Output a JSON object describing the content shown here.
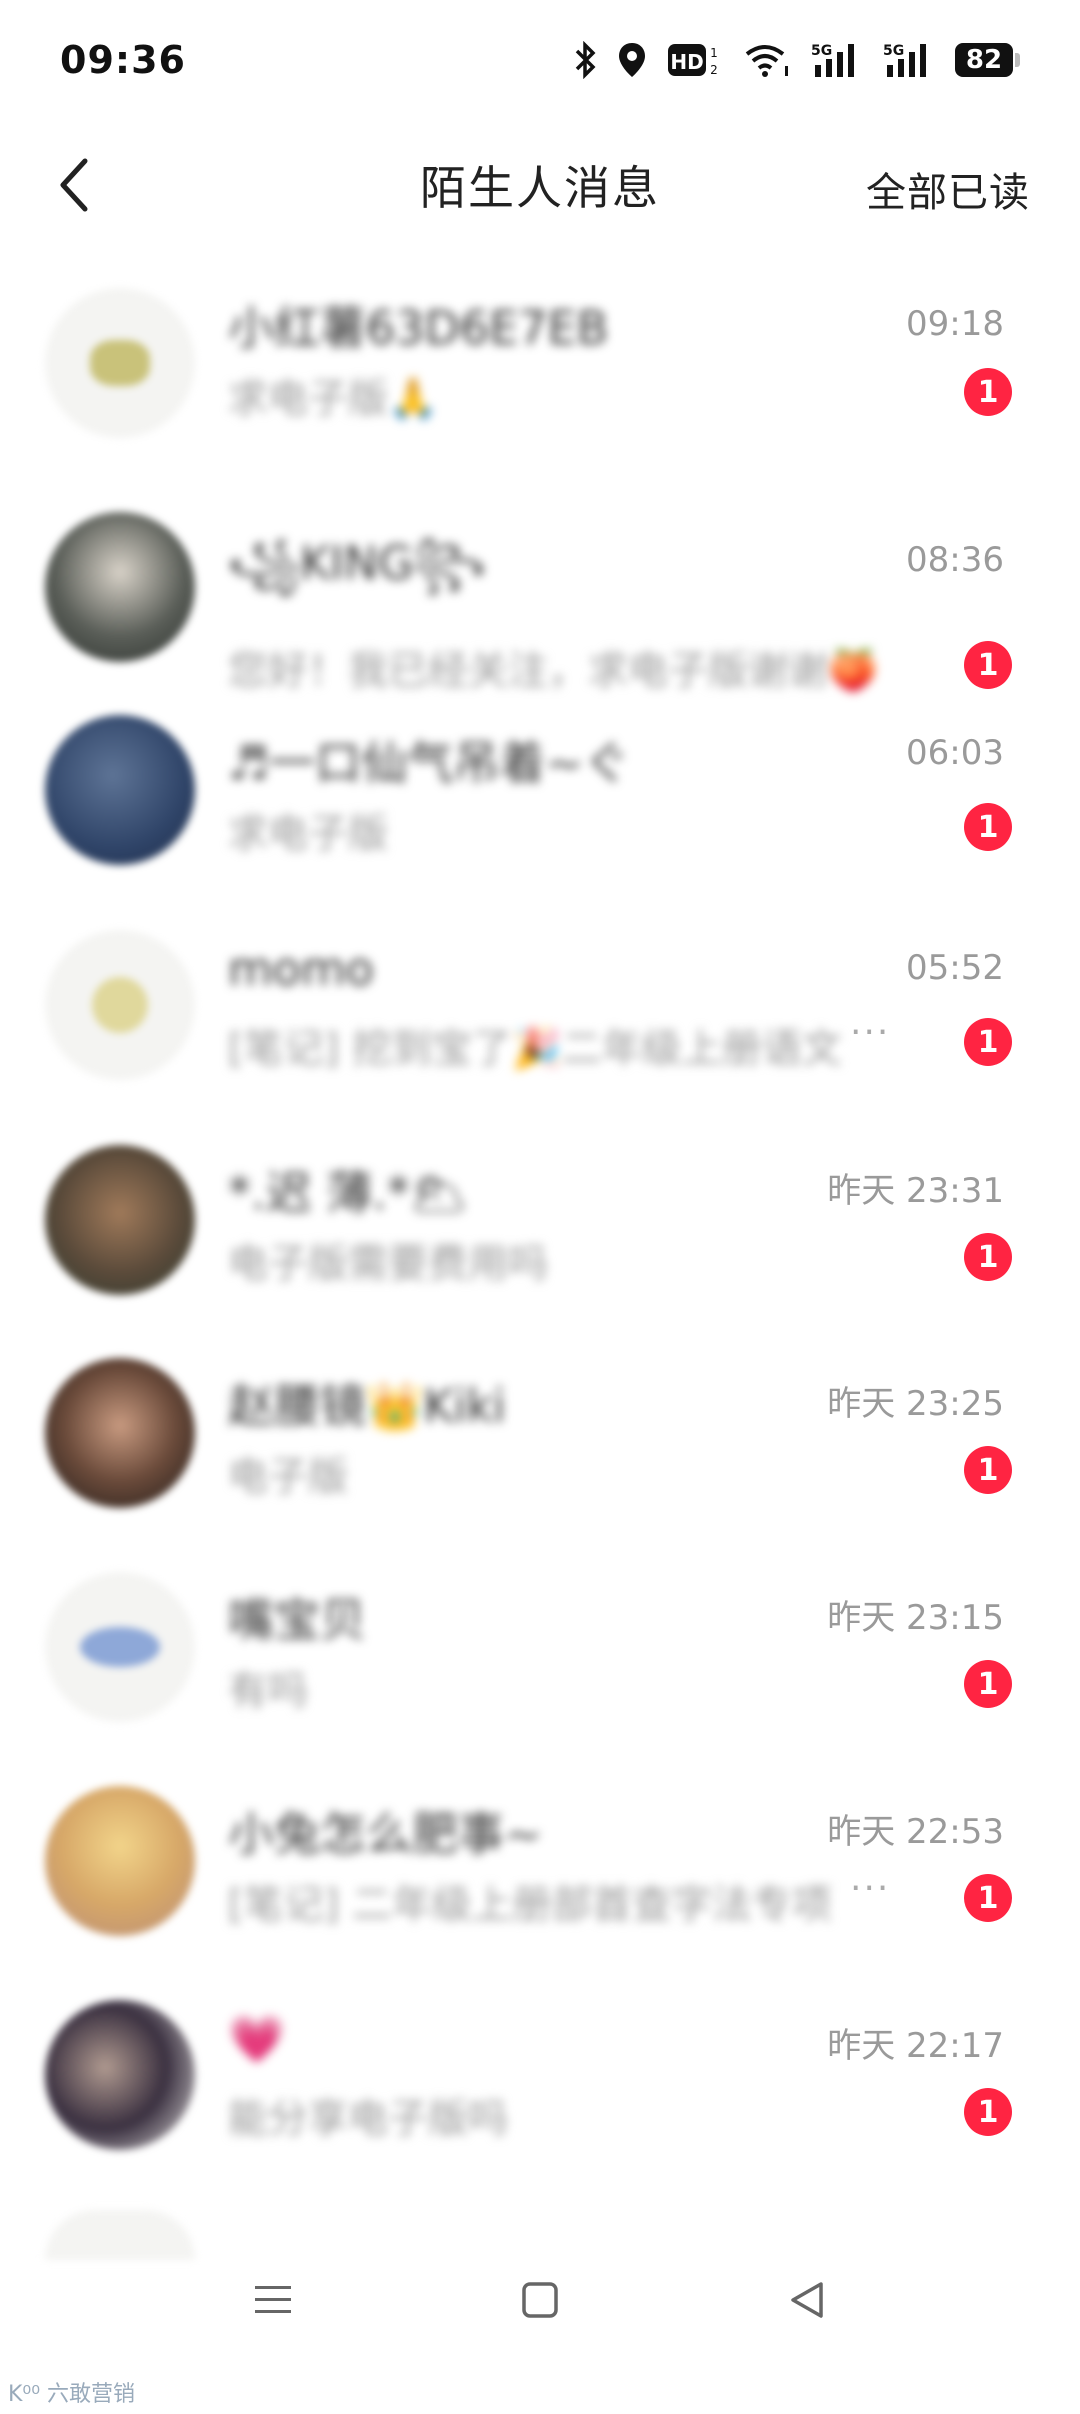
{
  "status_bar": {
    "time": "09:36",
    "battery": "82",
    "icons": [
      "bluetooth-icon",
      "location-icon",
      "hd-icon",
      "wifi-icon",
      "signal-5g-icon",
      "signal-5g-icon",
      "battery-icon"
    ]
  },
  "header": {
    "title": "陌生人消息",
    "mark_all_read": "全部已读"
  },
  "messages": [
    {
      "name": "小红薯63D6E7EB",
      "preview": "求电子版🙏",
      "time": "09:18",
      "unread": "1"
    },
    {
      "name": "꧁KING꧂",
      "preview": "您好！我已经关注，求电子版谢谢🍑",
      "time": "08:36",
      "unread": "1"
    },
    {
      "name": "♬一口仙气吊着~ぐ",
      "preview": "求电子版",
      "time": "06:03",
      "unread": "1"
    },
    {
      "name": "momo",
      "preview": "[笔记] 挖到宝了🎉二年级上册语文",
      "time": "05:52",
      "unread": "1"
    },
    {
      "name": "*.迟 薄.*🌥",
      "preview": "电子版需要费用吗",
      "time": "昨天 23:31",
      "unread": "1"
    },
    {
      "name": "赵腰镜👑Kiki",
      "preview": "电子版",
      "time": "昨天 23:25",
      "unread": "1"
    },
    {
      "name": "嘴宝贝",
      "preview": "有吗",
      "time": "昨天 23:15",
      "unread": "1"
    },
    {
      "name": "小兔怎么肥事~",
      "preview": "[笔记] 二年级上册部首查字法专项",
      "time": "昨天 22:53",
      "unread": "1"
    },
    {
      "name": "💗",
      "preview": "能分享电子版吗",
      "time": "昨天 22:17",
      "unread": "1"
    }
  ],
  "watermark": "K⁰⁰ 六敢营销",
  "colors": {
    "accent": "#ff2442",
    "time_text": "#9a9a9a"
  }
}
